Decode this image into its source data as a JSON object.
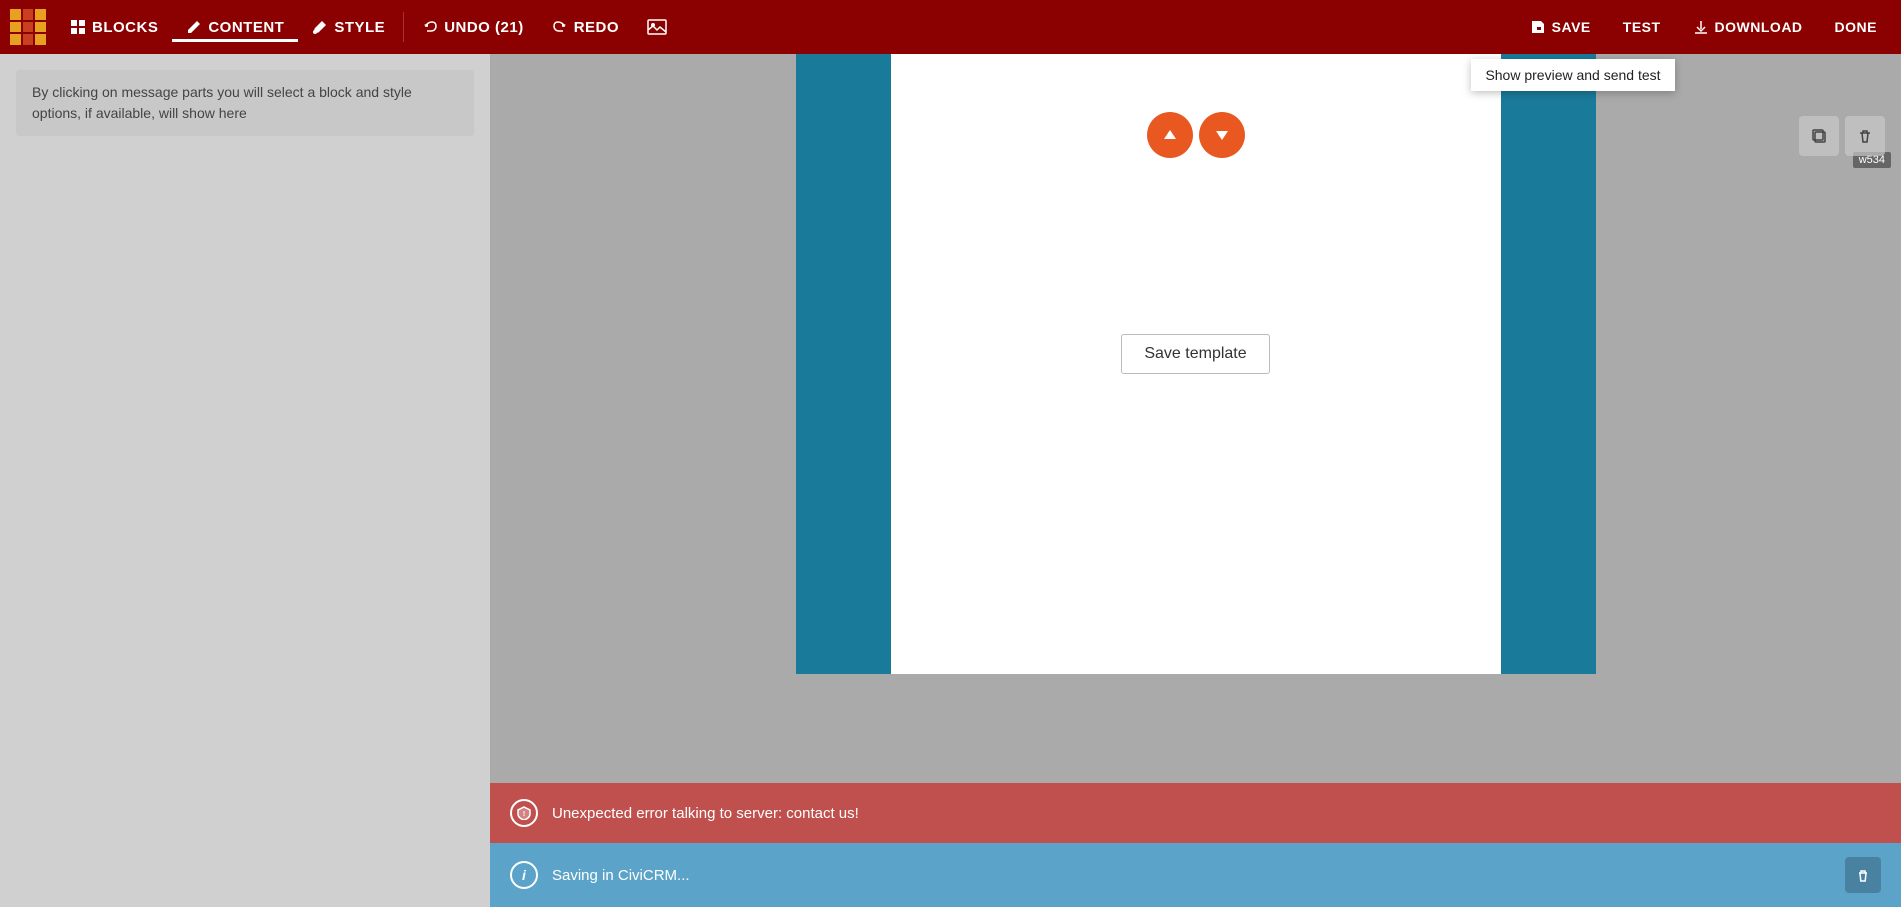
{
  "toolbar": {
    "logo_alt": "CiviCRM logo",
    "tabs": [
      {
        "id": "blocks",
        "label": "BLOCKS",
        "icon": "grid"
      },
      {
        "id": "content",
        "label": "CONTENT",
        "icon": "pencil",
        "active": true
      },
      {
        "id": "style",
        "label": "STYLE",
        "icon": "paintbrush"
      }
    ],
    "undo_label": "UNDO (21)",
    "redo_label": "REDO",
    "save_label": "SAVE",
    "test_label": "TEST",
    "download_label": "DOWNLOAD",
    "done_label": "DONE"
  },
  "sidebar": {
    "info_text": "By clicking on message parts you will select a block and style options, if available, will show here"
  },
  "canvas": {
    "width_badge": "w534",
    "save_template_label": "Save template"
  },
  "block_controls": {
    "up_label": "▲",
    "down_label": "▼"
  },
  "tooltip": {
    "text": "Show preview and send test"
  },
  "notifications": {
    "error": {
      "icon": "shield",
      "message": "Unexpected error talking to server: contact us!"
    },
    "info": {
      "icon": "i",
      "message": "Saving in CiviCRM..."
    }
  }
}
